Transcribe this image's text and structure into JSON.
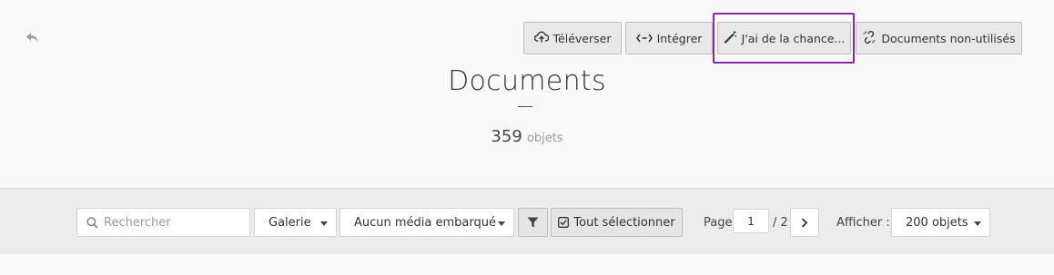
{
  "header": {
    "back_icon": "undo-arrow-icon",
    "actions": [
      {
        "label": "Téléverser",
        "icon": "cloud-upload-icon"
      },
      {
        "label": "Intégrer",
        "icon": "embed-code-icon"
      },
      {
        "label": "J'ai de la chance...",
        "icon": "magic-wand-icon"
      },
      {
        "label": "Documents non-utilisés",
        "icon": "unlink-icon"
      }
    ],
    "focused_action": "J'ai de la chance...",
    "focus_color": "#8a2a9c"
  },
  "main": {
    "title": "Documents",
    "count": "359",
    "count_label": "objets"
  },
  "toolbar": {
    "search_placeholder": "Rechercher",
    "view_select": "Galerie",
    "embed_select": "Aucun média embarqué",
    "filter_icon": "funnel-icon",
    "select_all": "Tout sélectionner",
    "page_label": "Page",
    "page_value": "1",
    "page_total": "/ 2",
    "next_icon": "chevron-right-icon",
    "show_label": "Afficher :",
    "show_select": "200 objets"
  }
}
